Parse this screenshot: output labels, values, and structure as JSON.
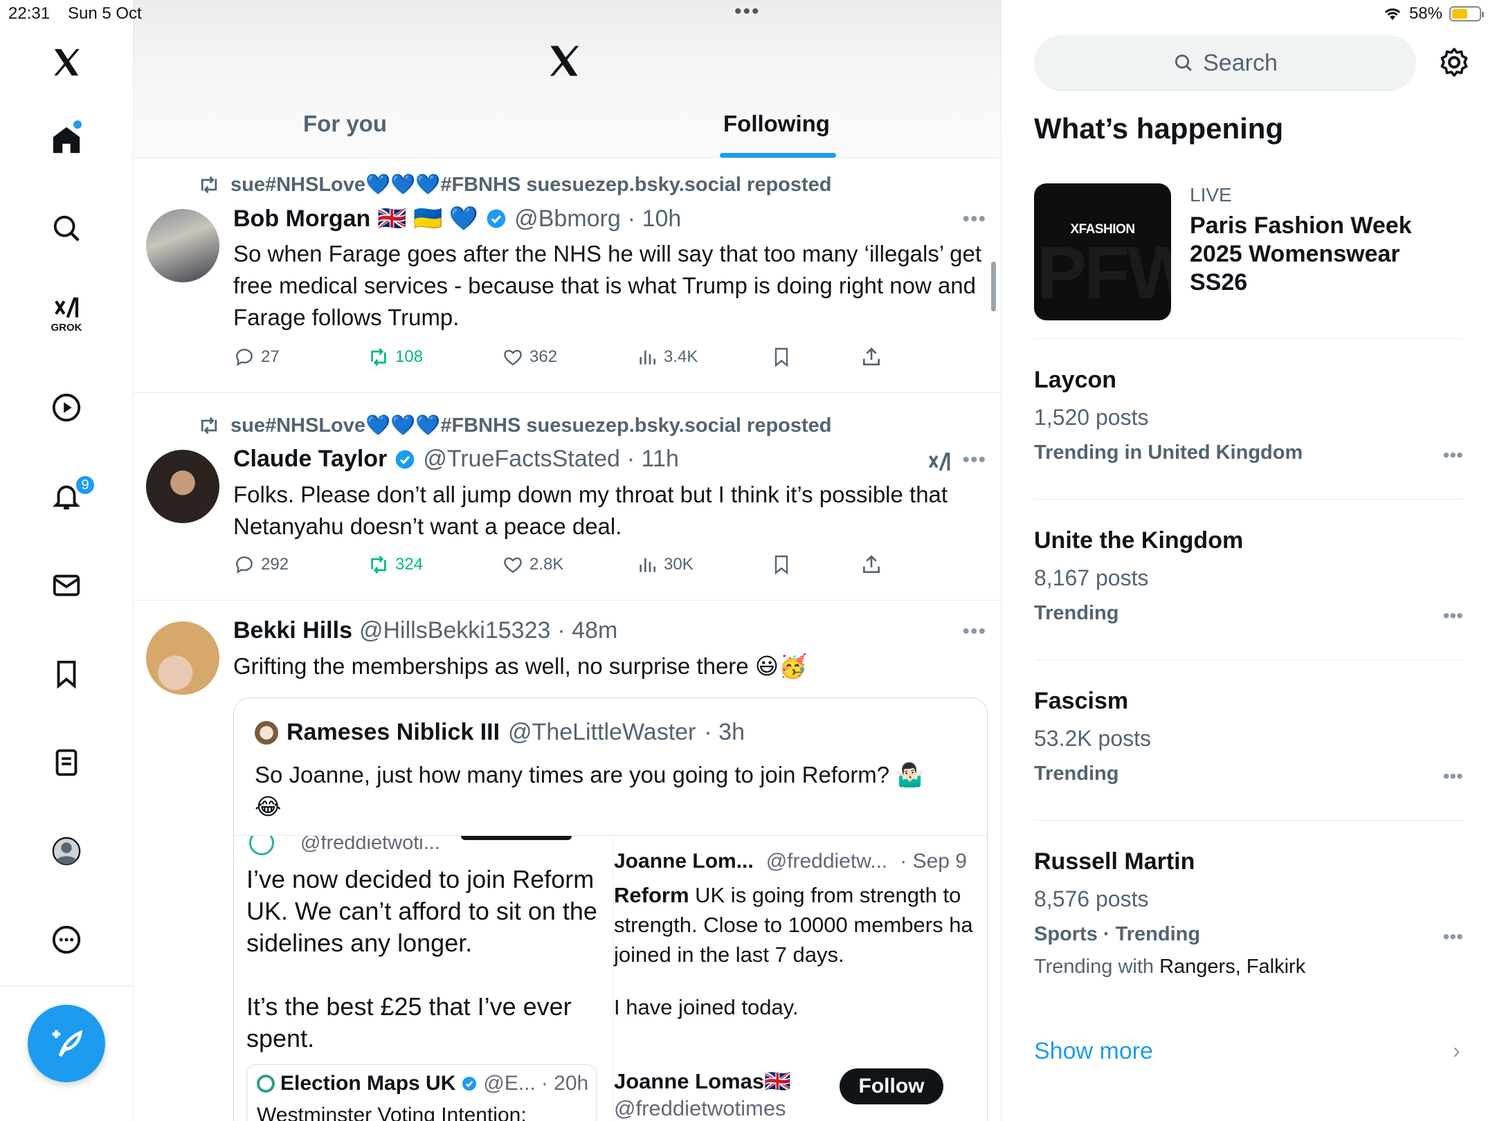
{
  "status_bar": {
    "time": "22:31",
    "date": "Sun 5 Oct",
    "battery": "58%",
    "battery_level": 0.58
  },
  "left_nav": {
    "grok_label": "GROK",
    "notifications_count": "9"
  },
  "header": {
    "tabs": [
      {
        "label": "For you"
      },
      {
        "label": "Following"
      }
    ],
    "active_tab": "Following"
  },
  "tweets": [
    {
      "reposted_by": "sue#NHSLove💙💙💙#FBNHS suesuezep.bsky.social reposted",
      "name": "Bob Morgan",
      "name_emoji": "🇬🇧 🇺🇦 💙",
      "handle": "@Bbmorg",
      "time": "· 10h",
      "text": "So when Farage goes after the NHS he will say that too many ‘illegals’ get free medical services - because that is what Trump is doing right now and Farage follows Trump.",
      "replies": "27",
      "reposts": "108",
      "likes": "362",
      "views": "3.4K"
    },
    {
      "reposted_by": "sue#NHSLove💙💙💙#FBNHS suesuezep.bsky.social reposted",
      "name": "Claude Taylor",
      "handle": "@TrueFactsStated",
      "time": "· 11h",
      "text": "Folks. Please don’t all jump down my throat but I think it’s possible that Netanyahu doesn’t want a peace deal.",
      "replies": "292",
      "reposts": "324",
      "likes": "2.8K",
      "views": "30K"
    },
    {
      "name": "Bekki Hills",
      "handle": "@HillsBekki15323",
      "time": "· 48m",
      "text": "Grifting the memberships as well, no surprise there 😃🥳"
    }
  ],
  "quote": {
    "name": "Rameses Niblick III",
    "handle": "@TheLittleWaster",
    "time": "· 3h",
    "text": "So Joanne, just how many times are you going to join Reform? 🤷🏻‍♂️ 😂",
    "left_handle": "@freddietwoti...",
    "left_text_1": "I’ve now decided to join Reform UK. We can’t afford to sit on the sidelines any longer.",
    "left_text_2": "It’s the best £25 that I’ve ever spent.",
    "left_embed_name": "Election Maps UK",
    "left_embed_handle": "@E...",
    "left_embed_time": "· 20h",
    "left_embed_text": "Westminster Voting Intention:",
    "right_name": "Joanne Lom...",
    "right_handle": "@freddietw...",
    "right_time": "· Sep 9",
    "right_text_bold": "Reform",
    "right_text": " UK is going from strength to strength. Close to 10000 members ha joined in the last 7 days.",
    "right_text_2": "I have joined today.",
    "right_bottom_name": "Joanne Lomas🇬🇧",
    "right_bottom_handle": "@freddietwotimes",
    "follow_label": "Follow"
  },
  "sidebar": {
    "search_placeholder": "Search",
    "title": "What’s happening",
    "live": {
      "label": "LIVE",
      "brand": "XFASHION",
      "title": "Paris Fashion Week 2025 Womenswear SS26"
    },
    "trends": [
      {
        "name": "Laycon",
        "count": "1,520 posts",
        "meta": "Trending in United Kingdom"
      },
      {
        "name": "Unite the Kingdom",
        "count": "8,167 posts",
        "meta": "Trending"
      },
      {
        "name": "Fascism",
        "count": "53.2K posts",
        "meta": "Trending"
      },
      {
        "name": "Russell Martin",
        "count": "8,576 posts",
        "meta": "Sports · Trending",
        "with_prefix": "Trending with ",
        "with": "Rangers, Falkirk"
      }
    ],
    "show_more": "Show more"
  },
  "colors": {
    "accent": "#1d9bf0",
    "repost_green": "#00ba7c",
    "text": "#0f1419",
    "muted": "#536471"
  }
}
